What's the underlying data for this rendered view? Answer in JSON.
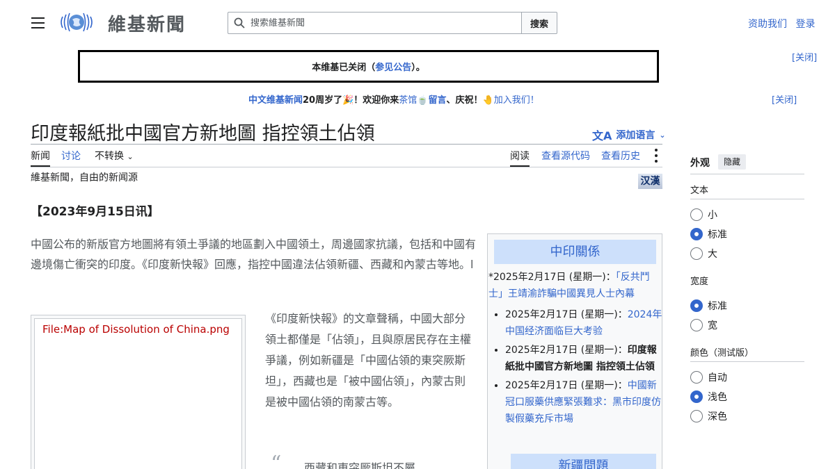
{
  "header": {
    "site_name": "維基新聞",
    "search_placeholder": "搜索維基新聞",
    "search_button": "搜索",
    "user_links": [
      "资助我们",
      "登录"
    ]
  },
  "notice": {
    "prefix": "本维基已关闭（",
    "link": "参见公告",
    "suffix": "）。",
    "close": "[关闭]"
  },
  "banner": {
    "part1": "中文维基新闻",
    "part2": "20周岁了🎉！欢迎你来",
    "part3": "茶馆",
    "part4": "🍵",
    "part5": "留言",
    "part6": "、庆祝！",
    "part7": "🤚",
    "part8": "加入我们！",
    "close": "[关闭]"
  },
  "page": {
    "title": "印度報紙批中國官方新地圖 指控領土佔領",
    "add_languages": "添加语言",
    "tabs": {
      "news": "新闻",
      "talk": "讨论",
      "variant": "不转换",
      "read": "阅读",
      "view_source": "查看源代码",
      "history": "查看历史"
    },
    "tagline": "維基新聞，自由的新闻源",
    "hanzi_toggle": "汉漢",
    "dateline": "【2023年9月15日讯】",
    "lead": "中國公布的新版官方地圖將有領土爭議的地區劃入中國領土，周邊國家抗議，包括和中國有邊境傷亡衝突的印度。《印度新快報》回應，指控中國違法佔領新疆、西藏和內蒙古等地。l",
    "figure_link": "File:Map of Dissolution of China.png",
    "para2": "《印度新快報》的文章聲稱，中國大部分領土都僅是「佔領」，且與原居民存在主權爭議，例如新疆是「中國佔領的東突厥斯坦」，西藏也是「被中國佔領」，內蒙古則是被中國佔領的南蒙古等。",
    "quote_mark": "“",
    "quote_text": "西藏和東突厥斯坦不屬"
  },
  "sidebox": {
    "heading": "中印關係",
    "first_item_date": "*2025年2月17日 (星期一)：",
    "first_item_link": "「反共鬥士」王靖渝詐騙中國異見人士內幕",
    "items": [
      {
        "date": "2025年2月17日 (星期一)：",
        "link": "2024年中国经济面临巨大考验",
        "bold": false
      },
      {
        "date": "2025年2月17日 (星期一)：",
        "link": "印度報紙批中國官方新地圖 指控領土佔領",
        "bold": true
      },
      {
        "date": "2025年2月17日 (星期一)：",
        "link": "中國新冠口服藥供應緊張難求：黑市印度仿製假藥充斥市場",
        "bold": false
      }
    ],
    "heading2": "新疆問題"
  },
  "appearance": {
    "title": "外观",
    "hide": "隐藏",
    "text_label": "文本",
    "text_options": [
      "小",
      "标准",
      "大"
    ],
    "width_label": "宽度",
    "width_options": [
      "标准",
      "宽"
    ],
    "color_label": "颜色（测试版）",
    "color_options": [
      "自动",
      "浅色",
      "深色"
    ]
  }
}
